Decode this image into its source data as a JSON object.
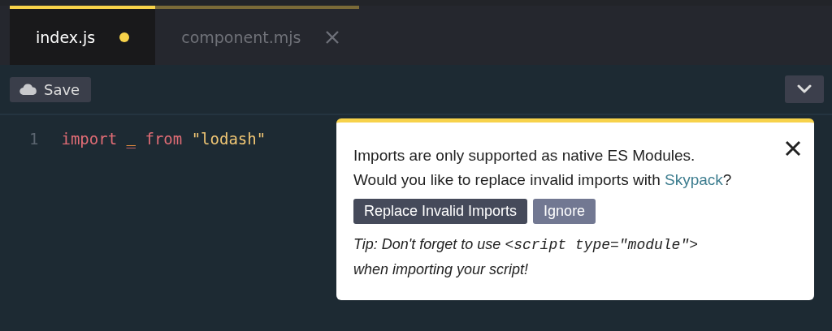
{
  "tabs": [
    {
      "label": "index.js",
      "selected": true,
      "modified": true,
      "closable": false
    },
    {
      "label": "component.mjs",
      "selected": false,
      "modified": false,
      "closable": true
    }
  ],
  "toolbar": {
    "save_label": "Save"
  },
  "code": [
    {
      "line": "1",
      "tokens": [
        {
          "kind": "keyword",
          "text": "import"
        },
        {
          "kind": "error",
          "text": "_"
        },
        {
          "kind": "keyword",
          "text": "from"
        },
        {
          "kind": "string",
          "text": "\"lodash\""
        }
      ]
    }
  ],
  "popup": {
    "message_line1": "Imports are only supported as native ES Modules.",
    "message_line2_before": "Would you like to replace invalid imports with",
    "link": "Skypack",
    "message_line2_after": "?",
    "buttons": [
      {
        "label": "Replace Invalid Imports",
        "kind": "primary"
      },
      {
        "label": "Ignore",
        "kind": "secondary"
      }
    ],
    "tip_before": "Tip: Don't forget to use",
    "tip_code": "<script type=\"module\">",
    "tip_after": "when importing your script!"
  }
}
